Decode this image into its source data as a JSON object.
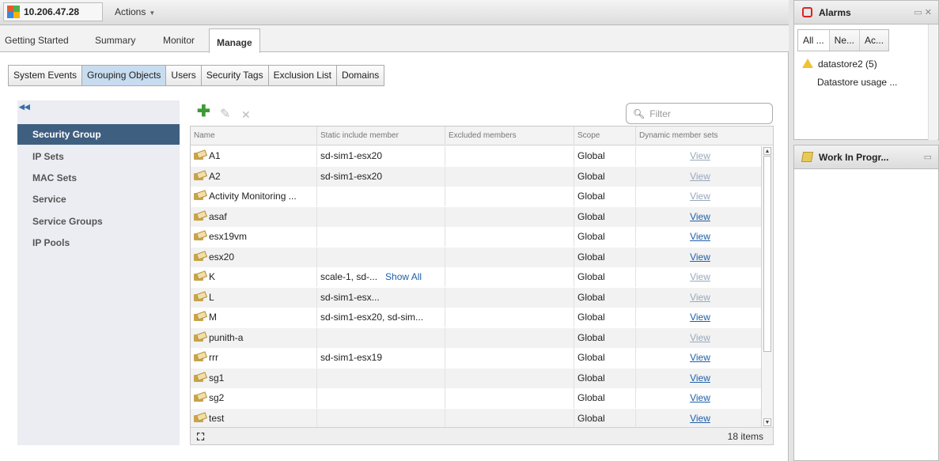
{
  "header": {
    "host": "10.206.47.28",
    "actions_label": "Actions"
  },
  "main_tabs": [
    "Getting Started",
    "Summary",
    "Monitor",
    "Manage"
  ],
  "sub_tabs": [
    "System Events",
    "Grouping Objects",
    "Users",
    "Security Tags",
    "Exclusion List",
    "Domains"
  ],
  "left_nav": [
    "Security Group",
    "IP Sets",
    "MAC Sets",
    "Service",
    "Service Groups",
    "IP Pools"
  ],
  "filter": {
    "placeholder": "Filter"
  },
  "table": {
    "columns": [
      "Name",
      "Static include member",
      "Excluded members",
      "Scope",
      "Dynamic member sets"
    ],
    "rows": [
      {
        "name": "A1",
        "static": "sd-sim1-esx20",
        "excluded": "",
        "scope": "Global",
        "dynamic": "View"
      },
      {
        "name": "A2",
        "static": "sd-sim1-esx20",
        "excluded": "",
        "scope": "Global",
        "dynamic": "View"
      },
      {
        "name": "Activity Monitoring ...",
        "static": "",
        "excluded": "",
        "scope": "Global",
        "dynamic": "View"
      },
      {
        "name": "asaf",
        "static": "",
        "excluded": "",
        "scope": "Global",
        "dynamic": "View"
      },
      {
        "name": "esx19vm",
        "static": "",
        "excluded": "",
        "scope": "Global",
        "dynamic": "View"
      },
      {
        "name": "esx20",
        "static": "",
        "excluded": "",
        "scope": "Global",
        "dynamic": "View"
      },
      {
        "name": "K",
        "static": "scale-1, sd-...",
        "static_link": "Show All",
        "excluded": "",
        "scope": "Global",
        "dynamic": "View"
      },
      {
        "name": "L",
        "static": "sd-sim1-esx...",
        "excluded": "",
        "scope": "Global",
        "dynamic": "View"
      },
      {
        "name": "M",
        "static": "sd-sim1-esx20, sd-sim...",
        "excluded": "",
        "scope": "Global",
        "dynamic": "View"
      },
      {
        "name": "punith-a",
        "static": "",
        "excluded": "",
        "scope": "Global",
        "dynamic": "View"
      },
      {
        "name": "rrr",
        "static": "sd-sim1-esx19",
        "excluded": "",
        "scope": "Global",
        "dynamic": "View"
      },
      {
        "name": "sg1",
        "static": "",
        "excluded": "",
        "scope": "Global",
        "dynamic": "View"
      },
      {
        "name": "sg2",
        "static": "",
        "excluded": "",
        "scope": "Global",
        "dynamic": "View"
      },
      {
        "name": "test",
        "static": "",
        "excluded": "",
        "scope": "Global",
        "dynamic": "View"
      }
    ],
    "item_count": "18 items"
  },
  "alarms": {
    "title": "Alarms",
    "tabs": [
      "All ...",
      "Ne...",
      "Ac..."
    ],
    "item_name": "datastore2 (5)",
    "item_desc": "Datastore usage ..."
  },
  "work_in_progress": {
    "title": "Work In Progr..."
  }
}
